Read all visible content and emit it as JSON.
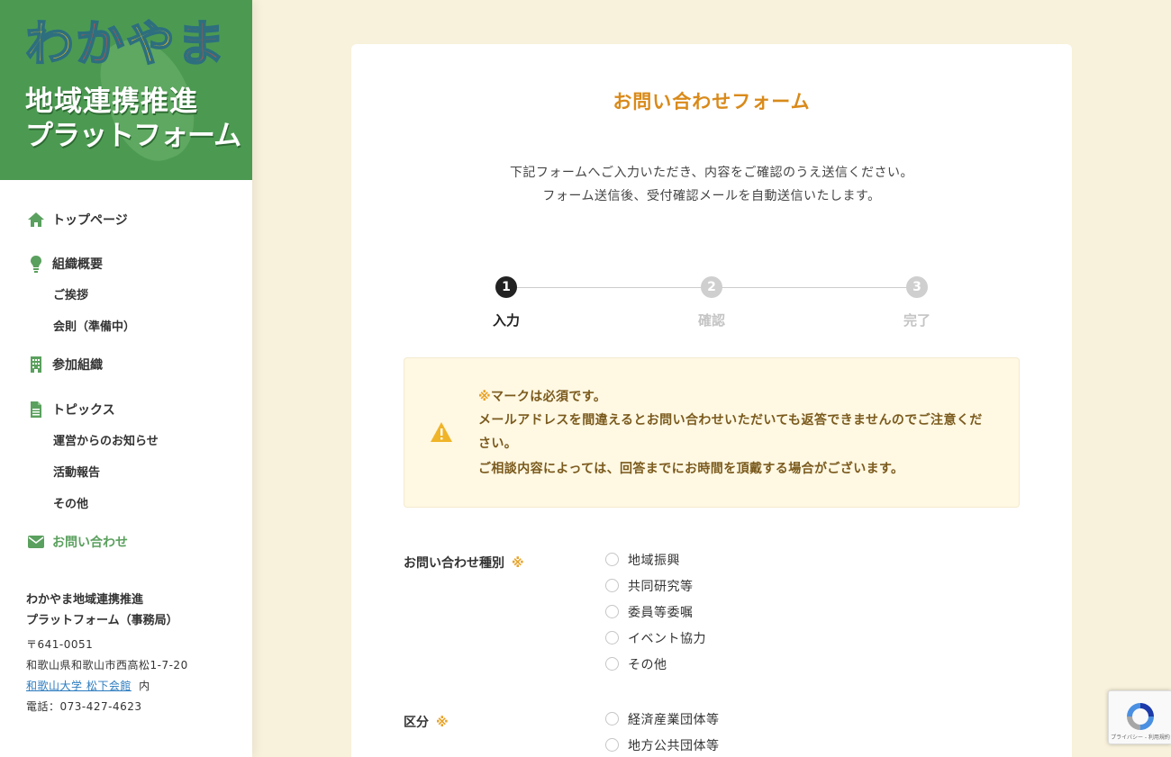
{
  "logo": {
    "line1": "わかやま",
    "line2": "地域連携推進",
    "line3": "プラットフォーム"
  },
  "sidebar": {
    "items": [
      {
        "label": "トップページ",
        "icon": "home-icon"
      },
      {
        "label": "組織概要",
        "icon": "lightbulb-icon",
        "children": [
          "ご挨拶",
          "会則（準備中）"
        ]
      },
      {
        "label": "参加組織",
        "icon": "building-icon"
      },
      {
        "label": "トピックス",
        "icon": "document-icon",
        "children": [
          "運営からのお知らせ",
          "活動報告",
          "その他"
        ]
      },
      {
        "label": "お問い合わせ",
        "icon": "envelope-icon",
        "active": true
      }
    ],
    "office": {
      "name1": "わかやま地域連携推進",
      "name2": "プラットフォーム（事務局）",
      "postal": "〒641-0051",
      "address": "和歌山県和歌山市西高松1-7-20",
      "link": "和歌山大学 松下会館",
      "link_suffix": "内",
      "phone": "電話：073-427-4623"
    }
  },
  "form": {
    "title": "お問い合わせフォーム",
    "intro_line1": "下記フォームへご入力いただき、内容をご確認のうえ送信ください。",
    "intro_line2": "フォーム送信後、受付確認メールを自動送信いたします。",
    "steps": [
      {
        "num": "1",
        "label": "入力"
      },
      {
        "num": "2",
        "label": "確認"
      },
      {
        "num": "3",
        "label": "完了"
      }
    ],
    "notice": {
      "req_mark": "※",
      "line1": "マークは必須です。",
      "line2": "メールアドレスを間違えるとお問い合わせいただいても返答できませんのでご注意ください。",
      "line3": "ご相談内容によっては、回答までにお時間を頂戴する場合がございます。"
    },
    "required_mark": "※",
    "fields": [
      {
        "label": "お問い合わせ種別",
        "options": [
          "地域振興",
          "共同研究等",
          "委員等委嘱",
          "イベント協力",
          "その他"
        ]
      },
      {
        "label": "区分",
        "options": [
          "経済産業団体等",
          "地方公共団体等"
        ]
      }
    ]
  },
  "recaptcha": {
    "text": "プライバシー - 利用規約"
  },
  "colors": {
    "accent": "#d98a1a",
    "sidebar_active": "#5aa05e",
    "logo_bg": "#4c9a52",
    "page_bg": "#f8f1db",
    "notice_bg": "#fff8e3"
  }
}
